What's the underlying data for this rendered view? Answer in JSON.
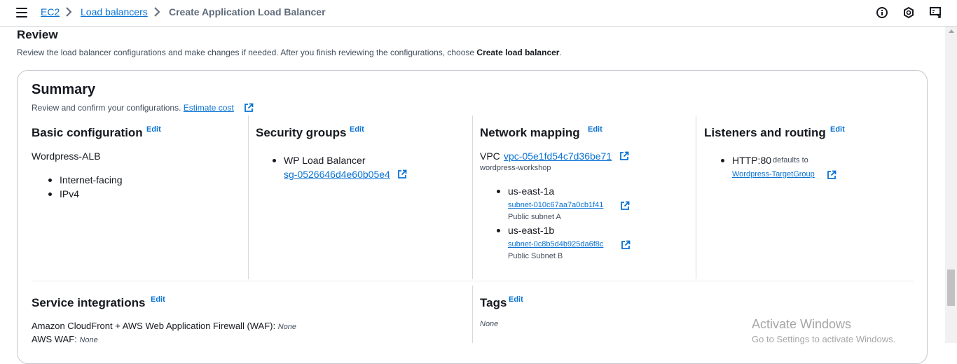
{
  "breadcrumbs": {
    "ec2": "EC2",
    "load_balancers": "Load balancers",
    "current": "Create Application Load Balancer"
  },
  "review": {
    "title": "Review",
    "description": "Review the load balancer configurations and make changes if needed. After you finish reviewing the configurations, choose ",
    "description_bold": "Create load balancer",
    "description_end": "."
  },
  "summary": {
    "title": "Summary",
    "description": "Review and confirm your configurations.",
    "estimate_cost": "Estimate cost"
  },
  "edit_label": "Edit",
  "basic": {
    "title": "Basic configuration",
    "name": "Wordpress-ALB",
    "items": [
      "Internet-facing",
      "IPv4"
    ]
  },
  "security": {
    "title": "Security groups",
    "group_name": "WP Load Balancer",
    "group_id": "sg-0526646d4e60b05e4"
  },
  "network": {
    "title": "Network mapping",
    "vpc_label": "VPC",
    "vpc_id": "vpc-05e1fd54c7d36be71",
    "vpc_name": "wordpress-workshop",
    "zones": [
      {
        "az": "us-east-1a",
        "subnet": "subnet-010c67aa7a0cb1f41",
        "subnet_name": "Public subnet A"
      },
      {
        "az": "us-east-1b",
        "subnet": "subnet-0c8b5d4b925da6f8c",
        "subnet_name": "Public Subnet B"
      }
    ]
  },
  "listeners": {
    "title": "Listeners and routing",
    "protocol": "HTTP:80",
    "defaults_to": "defaults to",
    "target_group": "Wordpress-TargetGroup"
  },
  "service": {
    "title": "Service integrations",
    "cloudfront_label": "Amazon CloudFront + AWS Web Application Firewall (WAF):",
    "cloudfront_value": "None",
    "waf_label": "AWS WAF:",
    "waf_value": "None"
  },
  "tags": {
    "title": "Tags",
    "value": "None"
  },
  "watermark": {
    "line1": "Activate Windows",
    "line2": "Go to Settings to activate Windows."
  },
  "colors": {
    "link": "#0972d3",
    "text": "#16191f",
    "muted": "#414d5c"
  }
}
